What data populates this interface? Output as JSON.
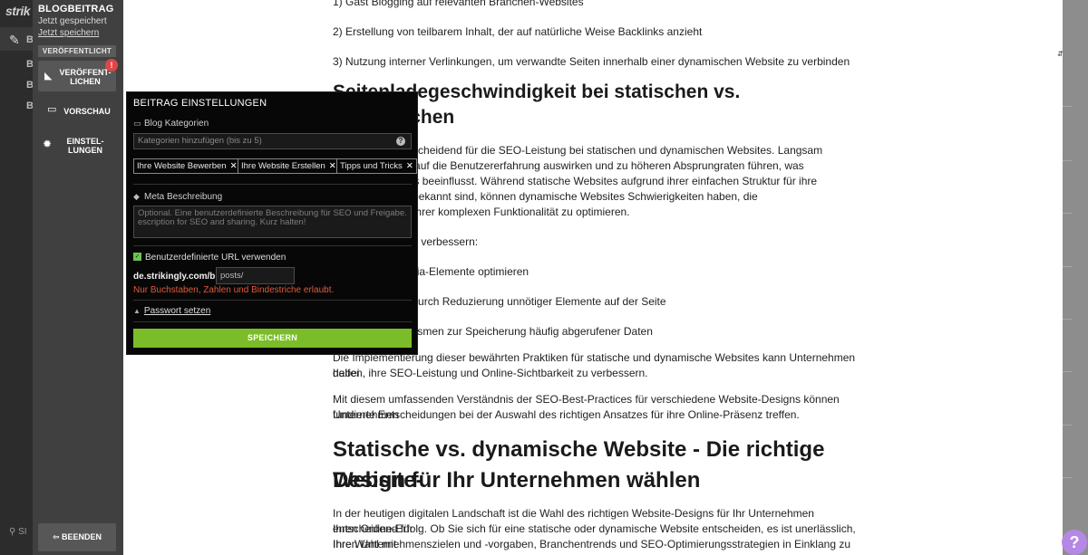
{
  "rail": {
    "logo": "strik",
    "nav_letters": [
      "B",
      "B",
      "B",
      "B"
    ],
    "search_label": "SI"
  },
  "panel": {
    "title": "BLOGBEITRAG",
    "saved_status": "Jetzt gespeichert",
    "save_now_link": "Jetzt speichern",
    "status_badge": "VERÖFFENTLICHT",
    "publish_label": "VERÖFFENT-\nLICHEN",
    "alert_badge": "!",
    "preview_label": "VORSCHAU",
    "settings_label": "EINSTEL-\nLUNGEN",
    "exit_label": "BEENDEN"
  },
  "popup": {
    "title": "BEITRAG EINSTELLUNGEN",
    "categories_label": "Blog Kategorien",
    "categories_placeholder": "Kategorien hinzufügen (bis zu 5)",
    "tags": [
      "Ihre Website Bewerben",
      "Ihre Website Erstellen",
      "Tipps und Tricks"
    ],
    "tag_remove": "✕",
    "meta_label": "Meta Beschreibung",
    "meta_placeholder": "Optional. Eine benutzerdefinierte Beschreibung für SEO und Freigabe. escription for SEO and sharing. Kurz halten!",
    "custom_url_label": "Benutzerdefinierte URL verwenden",
    "url_prefix": "de.strikingly.com/blog/",
    "url_value": "posts/",
    "url_hint": "Nur Buchstaben, Zahlen und Bindestriche erlaubt.",
    "password_link": "Passwort setzen",
    "save_button": "SPEICHERN"
  },
  "article": {
    "list_top": [
      "1) Gast Blogging auf relevanten Branchen-Websites",
      "2) Erstellung von teilbarem Inhalt, der auf natürliche Weise Backlinks anzieht",
      "3) Nutzung interner Verlinkungen, um verwandte Seiten innerhalb einer dynamischen Website zu verbinden"
    ],
    "heading1": "Seitenladegeschwindigkeit bei statischen vs. dynamischen",
    "para1_lines": [
      "windigkeit ist entscheidend für die SEO-Leistung bei statischen und dynamischen Websites. Langsam",
      "hen sich negativ auf die Benutzererfahrung auswirken und zu höheren Absprungraten führen, was",
      "schinen-Rankings beeinflusst. Während statische Websites aufgrund ihrer einfachen Struktur für ihre",
      "geschwindigkeit bekannt sind, können dynamische Websites Schwierigkeiten haben, die",
      "digkeit aufgrund ihrer komplexen Funktionalität zu optimieren."
    ],
    "tips_intro": "eschwindigkeit zu verbessern:",
    "tips": [
      "ren und Multimedia-Elemente optimieren",
      "HTTP-Anfragen durch Reduzierung unnötiger Elemente auf der Seite",
      "Caching-Mechanismen zur Speicherung häufig abgerufener Daten"
    ],
    "para2_lines": [
      "Die Implementierung dieser bewährten Praktiken für statische und dynamische Websites kann Unternehmen dabei",
      "helfen, ihre SEO-Leistung und Online-Sichtbarkeit zu verbessern."
    ],
    "para3_lines": [
      "Mit diesem umfassenden Verständnis der SEO-Best-Practices für verschiedene Website-Designs können Unternehmen",
      "fundierte Entscheidungen bei der Auswahl des richtigen Ansatzes für ihre Online-Präsenz treffen."
    ],
    "heading2_lines": [
      "Statische vs. dynamische Website - Die richtige Website-",
      "Design für Ihr Unternehmen wählen"
    ],
    "para4_lines": [
      "In der heutigen digitalen Landschaft ist die Wahl des richtigen Website-Designs für Ihr Unternehmen entscheidend für",
      "Ihren Online-Erfolg. Ob Sie sich für eine statische oder dynamische Website entscheiden, es ist unerlässlich, Ihre Wahl mit",
      "Ihren Unternehmenszielen und -vorgaben, Branchentrends und SEO-Optimierungsstrategien in Einklang zu bringen."
    ]
  },
  "help_button": "?"
}
